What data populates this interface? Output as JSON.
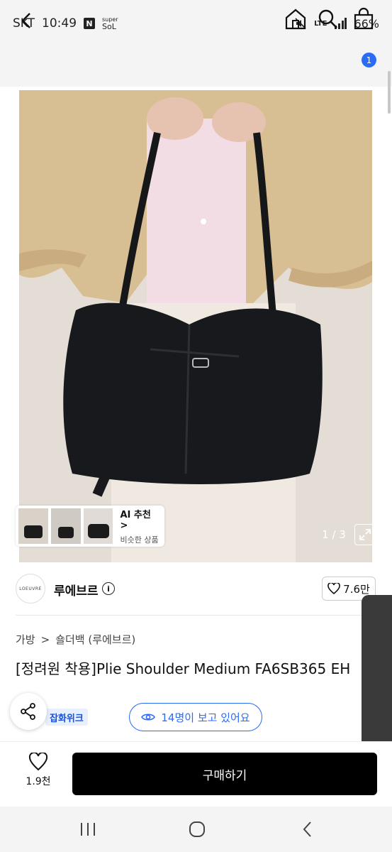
{
  "status_bar": {
    "carrier": "SKT",
    "time": "10:49",
    "app_badge": "N",
    "sol_top": "super",
    "sol_bottom": "SoL",
    "network": "LTE",
    "battery": "66%"
  },
  "header": {
    "cart_count": "1"
  },
  "image": {
    "counter": "1 / 3",
    "ai_title": "AI 추천 >",
    "ai_subtitle": "비슷한 상품"
  },
  "brand": {
    "logo_text": "LOEUVRE",
    "name": "루에브르",
    "likes": "7.6만"
  },
  "product": {
    "category_1": "가방",
    "category_sep": ">",
    "category_2": "숄더백 (루에브르)",
    "title": "[정려원 착용]Plie Shoulder Medium FA6SB365 EH",
    "badge": "잡화위크",
    "viewers": "14명이 보고 있어요"
  },
  "bottom": {
    "wish_count": "1.9천",
    "buy_label": "구매하기"
  },
  "colors": {
    "accent": "#2a6cf5",
    "buy_button": "#000000"
  }
}
